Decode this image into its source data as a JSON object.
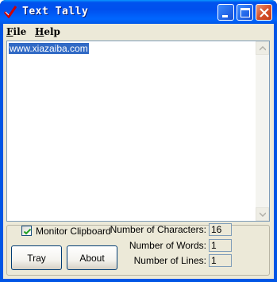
{
  "window": {
    "title": "Text Tally",
    "icon": "app-check-icon"
  },
  "titlebar_buttons": {
    "minimize": "minimize-icon",
    "maximize": "maximize-icon",
    "close": "close-icon"
  },
  "menu": {
    "file_underline": "F",
    "file_rest": "ile",
    "help_underline": "H",
    "help_rest": "elp"
  },
  "editor": {
    "content": "www.xiazaiba.com",
    "selected": true
  },
  "options": {
    "monitor_clipboard_label": "Monitor Clipboard",
    "monitor_clipboard_checked": true
  },
  "buttons": {
    "tray": "Tray",
    "about": "About"
  },
  "stats": {
    "characters_label": "Number of Characters:",
    "characters_value": "16",
    "words_label": "Number of Words:",
    "words_value": "1",
    "lines_label": "Number of Lines:",
    "lines_value": "1"
  },
  "colors": {
    "titlebar": "#0055e5",
    "selection": "#316ac5",
    "client_bg": "#ece9d8"
  }
}
